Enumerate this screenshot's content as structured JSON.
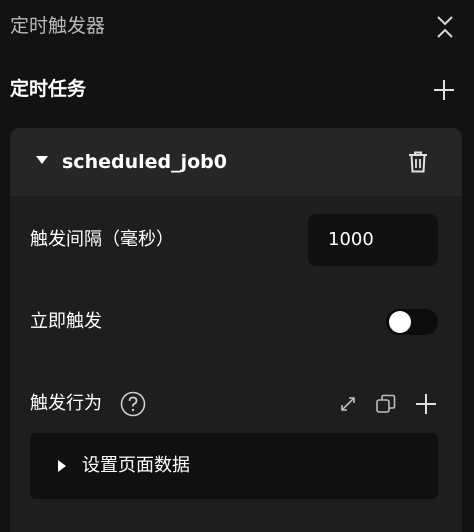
{
  "header": {
    "title": "定时触发器"
  },
  "section": {
    "title": "定时任务"
  },
  "job": {
    "name": "scheduled_job0",
    "interval": {
      "label": "触发间隔（毫秒）",
      "value": "1000"
    },
    "immediate": {
      "label": "立即触发",
      "enabled": false
    },
    "actions": {
      "label": "触发行为",
      "items": [
        {
          "label": "设置页面数据"
        }
      ]
    }
  },
  "colors": {
    "background": "#121212",
    "card": "#1e1e1e",
    "card_header": "#262626",
    "input": "#111111",
    "icon": "#d8d8d8"
  }
}
